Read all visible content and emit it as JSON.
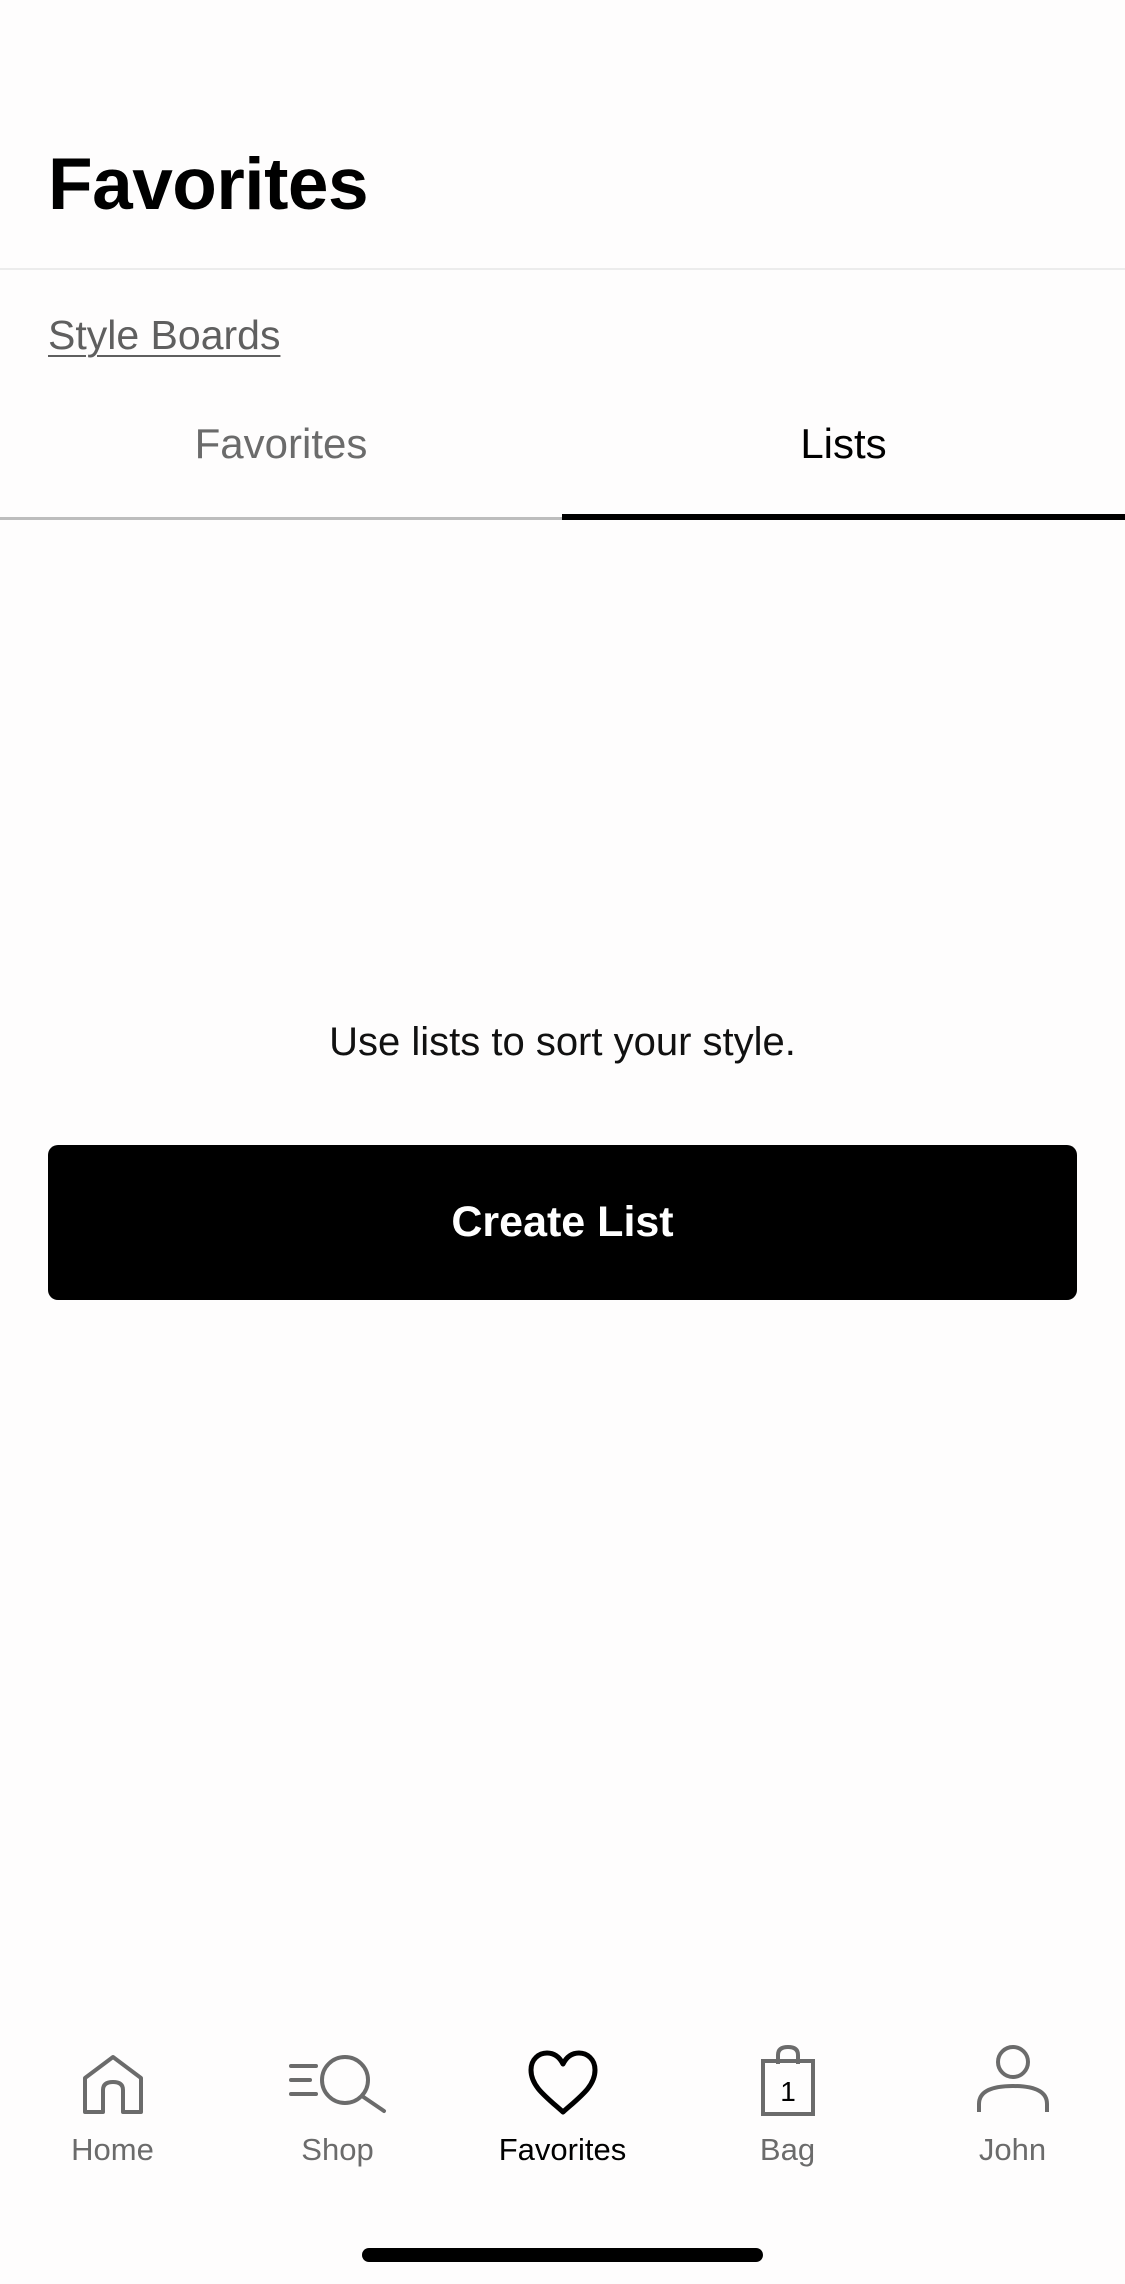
{
  "header": {
    "title": "Favorites"
  },
  "links": {
    "style_boards": "Style Boards"
  },
  "tabs": [
    {
      "label": "Favorites",
      "active": false
    },
    {
      "label": "Lists",
      "active": true
    }
  ],
  "empty_state": {
    "message": "Use lists to sort your style.",
    "button_label": "Create List"
  },
  "tab_bar": {
    "items": [
      {
        "label": "Home",
        "icon": "home-icon",
        "active": false
      },
      {
        "label": "Shop",
        "icon": "search-icon",
        "active": false
      },
      {
        "label": "Favorites",
        "icon": "heart-icon",
        "active": true
      },
      {
        "label": "Bag",
        "icon": "shopping-bag-icon",
        "active": false,
        "badge": "1"
      },
      {
        "label": "John",
        "icon": "person-icon",
        "active": false
      }
    ]
  },
  "colors": {
    "background": "#fefdfd",
    "primary": "#000000",
    "inactive_text": "#6b6b6b",
    "link": "#5f5f5f"
  }
}
